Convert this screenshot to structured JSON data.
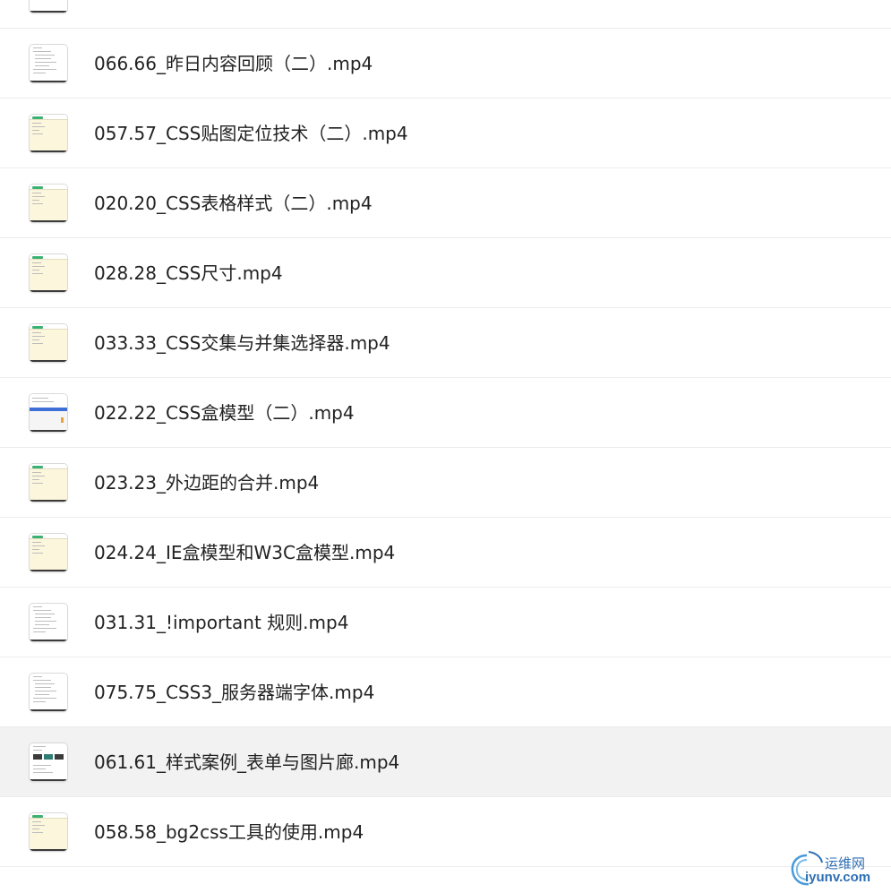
{
  "files": [
    {
      "name": "",
      "thumb": "dark-partial",
      "selected": false
    },
    {
      "name": "066.66_昨日内容回顾（二）.mp4",
      "thumb": "doc",
      "selected": false
    },
    {
      "name": "057.57_CSS贴图定位技术（二）.mp4",
      "thumb": "cream",
      "selected": false
    },
    {
      "name": "020.20_CSS表格样式（二）.mp4",
      "thumb": "cream",
      "selected": false
    },
    {
      "name": "028.28_CSS尺寸.mp4",
      "thumb": "cream",
      "selected": false
    },
    {
      "name": "033.33_CSS交集与并集选择器.mp4",
      "thumb": "cream",
      "selected": false
    },
    {
      "name": "022.22_CSS盒模型（二）.mp4",
      "thumb": "split",
      "selected": false
    },
    {
      "name": "023.23_外边距的合并.mp4",
      "thumb": "cream",
      "selected": false
    },
    {
      "name": "024.24_IE盒模型和W3C盒模型.mp4",
      "thumb": "cream",
      "selected": false
    },
    {
      "name": "031.31_!important 规则.mp4",
      "thumb": "doc",
      "selected": false
    },
    {
      "name": "075.75_CSS3_服务器端字体.mp4",
      "thumb": "doc",
      "selected": false
    },
    {
      "name": "061.61_样式案例_表单与图片廊.mp4",
      "thumb": "images",
      "selected": true
    },
    {
      "name": "058.58_bg2css工具的使用.mp4",
      "thumb": "cream",
      "selected": false
    }
  ],
  "watermark": {
    "cn": "运维网",
    "en": "iyunv.com"
  }
}
